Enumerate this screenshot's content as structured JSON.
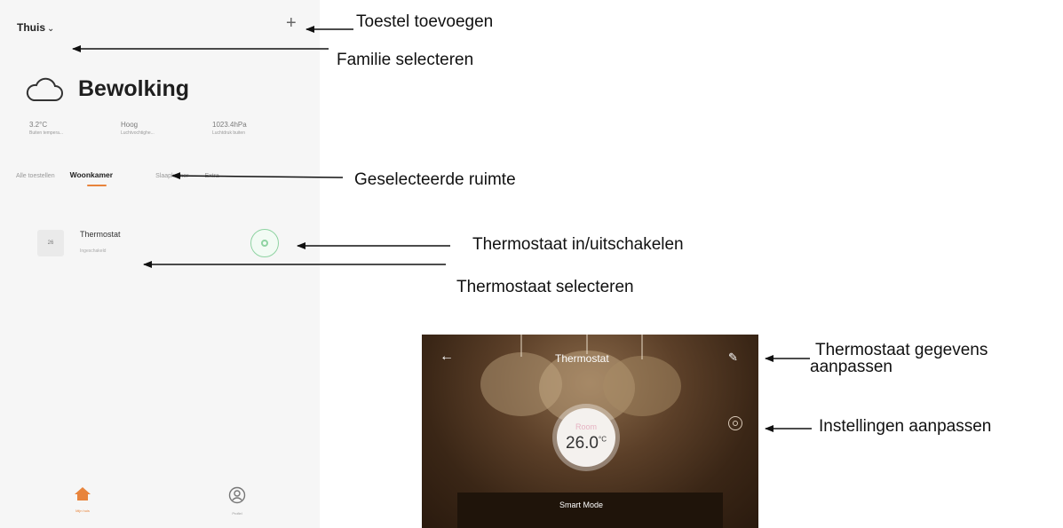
{
  "phone": {
    "family": "Thuis",
    "weather": {
      "condition": "Bewolking",
      "metrics": [
        {
          "value": "3.2°C",
          "label": "Buiten tempera..."
        },
        {
          "value": "Hoog",
          "label": "Luchtvochtighe..."
        },
        {
          "value": "1023.4hPa",
          "label": "Luchtdruk buiten"
        }
      ]
    },
    "tabs": [
      "Alle toestellen",
      "Woonkamer",
      "Slaapkamer",
      "Extra"
    ],
    "device": {
      "icon_text": "26",
      "name": "Thermostat",
      "status": "Ingeschakeld"
    },
    "nav": {
      "home": "Mijn huis",
      "profile": "Profiel"
    }
  },
  "detail": {
    "title": "Thermostat",
    "dial_label": "Room",
    "temperature": "26.0",
    "unit": "°C",
    "mode": "Smart Mode"
  },
  "annotations": {
    "add_device": "Toestel toevoegen",
    "select_family": "Familie selecteren",
    "selected_room": "Geselecteerde ruimte",
    "toggle_thermostat": "Thermostaat in/uitschakelen",
    "select_thermostat": "Thermostaat selecteren",
    "edit_thermostat_1": "Thermostaat gegevens",
    "edit_thermostat_2": "aanpassen",
    "adjust_settings": "Instellingen aanpassen"
  }
}
